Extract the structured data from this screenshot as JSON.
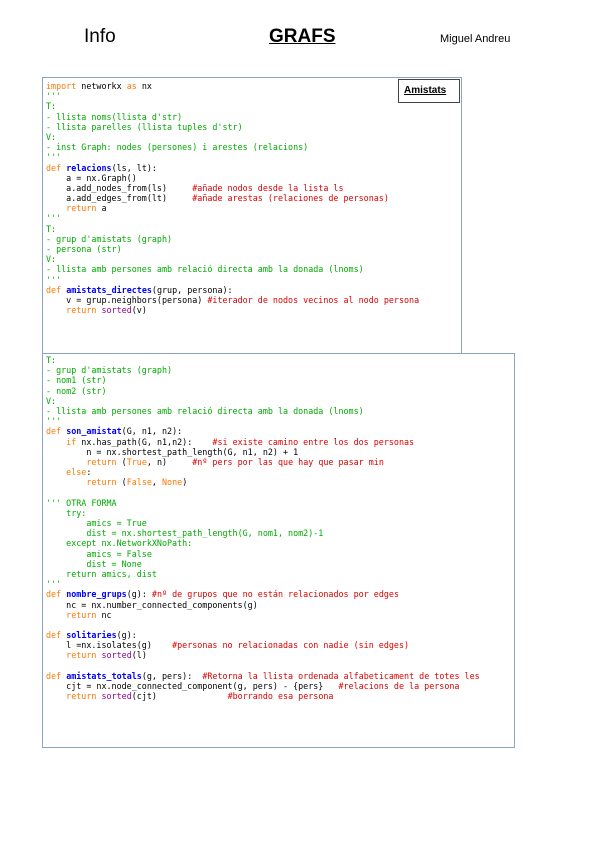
{
  "header": {
    "left": "Info",
    "title": "GRAFS",
    "author": "Miguel Andreu"
  },
  "tag": "Amistats",
  "block1": [
    [
      [
        "kw",
        "import"
      ],
      [
        "txt",
        " networkx "
      ],
      [
        "kw",
        "as"
      ],
      [
        "txt",
        " nx"
      ]
    ],
    [
      [
        "str",
        "'''"
      ]
    ],
    [
      [
        "str",
        "T:"
      ]
    ],
    [
      [
        "str",
        "- llista noms(llista d'str)"
      ]
    ],
    [
      [
        "str",
        "- llista parelles (llista tuples d'str)"
      ]
    ],
    [
      [
        "str",
        "V:"
      ]
    ],
    [
      [
        "str",
        "- inst Graph: nodes (persones) i arestes (relacions)"
      ]
    ],
    [
      [
        "str",
        "'''"
      ]
    ],
    [
      [
        "kw",
        "def"
      ],
      [
        "txt",
        " "
      ],
      [
        "fn",
        "relacions"
      ],
      [
        "txt",
        "(ls, lt):"
      ]
    ],
    [
      [
        "txt",
        "    a = nx.Graph()"
      ]
    ],
    [
      [
        "txt",
        "    a.add_nodes_from(ls)     "
      ],
      [
        "cmt",
        "#añade nodos desde la lista ls"
      ]
    ],
    [
      [
        "txt",
        "    a.add_edges_from(lt)     "
      ],
      [
        "cmt",
        "#añade arestas (relaciones de personas)"
      ]
    ],
    [
      [
        "txt",
        "    "
      ],
      [
        "kw",
        "return"
      ],
      [
        "txt",
        " a"
      ]
    ],
    [
      [
        "str",
        "'''"
      ]
    ],
    [
      [
        "str",
        "T:"
      ]
    ],
    [
      [
        "str",
        "- grup d'amistats (graph)"
      ]
    ],
    [
      [
        "str",
        "- persona (str)"
      ]
    ],
    [
      [
        "str",
        "V:"
      ]
    ],
    [
      [
        "str",
        "- llista amb persones amb relació directa amb la donada (lnoms)"
      ]
    ],
    [
      [
        "str",
        "'''"
      ]
    ],
    [
      [
        "kw",
        "def"
      ],
      [
        "txt",
        " "
      ],
      [
        "fn",
        "amistats_directes"
      ],
      [
        "txt",
        "(grup, persona):"
      ]
    ],
    [
      [
        "txt",
        "    v = grup.neighbors(persona) "
      ],
      [
        "cmt",
        "#iterador de nodos vecinos al nodo persona"
      ]
    ],
    [
      [
        "txt",
        "    "
      ],
      [
        "kw",
        "return"
      ],
      [
        "txt",
        " "
      ],
      [
        "bi",
        "sorted"
      ],
      [
        "txt",
        "(v)"
      ]
    ]
  ],
  "block2": [
    [
      [
        "str",
        "T:"
      ]
    ],
    [
      [
        "str",
        "- grup d'amistats (graph)"
      ]
    ],
    [
      [
        "str",
        "- nom1 (str)"
      ]
    ],
    [
      [
        "str",
        "- nom2 (str)"
      ]
    ],
    [
      [
        "str",
        "V:"
      ]
    ],
    [
      [
        "str",
        "- llista amb persones amb relació directa amb la donada (lnoms)"
      ]
    ],
    [
      [
        "str",
        "'''"
      ]
    ],
    [
      [
        "kw",
        "def"
      ],
      [
        "txt",
        " "
      ],
      [
        "fn",
        "son_amistat"
      ],
      [
        "txt",
        "(G, n1, n2):"
      ]
    ],
    [
      [
        "txt",
        "    "
      ],
      [
        "kw",
        "if"
      ],
      [
        "txt",
        " nx.has_path(G, n1,n2):    "
      ],
      [
        "cmt",
        "#si existe camino entre los dos personas"
      ]
    ],
    [
      [
        "txt",
        "        n = nx.shortest_path_length(G, n1, n2) + 1"
      ]
    ],
    [
      [
        "txt",
        "        "
      ],
      [
        "kw",
        "return"
      ],
      [
        "txt",
        " ("
      ],
      [
        "kw",
        "True"
      ],
      [
        "txt",
        ", n)     "
      ],
      [
        "cmt",
        "#nº pers por las que hay que pasar min"
      ]
    ],
    [
      [
        "txt",
        "    "
      ],
      [
        "kw",
        "else"
      ],
      [
        "txt",
        ":"
      ]
    ],
    [
      [
        "txt",
        "        "
      ],
      [
        "kw",
        "return"
      ],
      [
        "txt",
        " ("
      ],
      [
        "kw",
        "False"
      ],
      [
        "txt",
        ", "
      ],
      [
        "kw",
        "None"
      ],
      [
        "txt",
        ")"
      ]
    ],
    [
      [
        "txt",
        ""
      ]
    ],
    [
      [
        "str",
        "''' OTRA FORMA"
      ]
    ],
    [
      [
        "str",
        "    try:"
      ]
    ],
    [
      [
        "str",
        "        amics = True"
      ]
    ],
    [
      [
        "str",
        "        dist = nx.shortest_path_length(G, nom1, nom2)-1"
      ]
    ],
    [
      [
        "str",
        "    except nx.NetworkXNoPath:"
      ]
    ],
    [
      [
        "str",
        "        amics = False"
      ]
    ],
    [
      [
        "str",
        "        dist = None"
      ]
    ],
    [
      [
        "str",
        "    return amics, dist"
      ]
    ],
    [
      [
        "str",
        "'''"
      ]
    ],
    [
      [
        "kw",
        "def"
      ],
      [
        "txt",
        " "
      ],
      [
        "fn",
        "nombre_grups"
      ],
      [
        "txt",
        "(g): "
      ],
      [
        "cmt",
        "#nº de grupos que no están relacionados por edges"
      ]
    ],
    [
      [
        "txt",
        "    nc = nx.number_connected_components(g)"
      ]
    ],
    [
      [
        "txt",
        "    "
      ],
      [
        "kw",
        "return"
      ],
      [
        "txt",
        " nc"
      ]
    ],
    [
      [
        "txt",
        ""
      ]
    ],
    [
      [
        "kw",
        "def"
      ],
      [
        "txt",
        " "
      ],
      [
        "fn",
        "solitaries"
      ],
      [
        "txt",
        "(g):"
      ]
    ],
    [
      [
        "txt",
        "    l =nx.isolates(g)    "
      ],
      [
        "cmt",
        "#personas no relacionadas con nadie (sin edges)"
      ]
    ],
    [
      [
        "txt",
        "    "
      ],
      [
        "kw",
        "return"
      ],
      [
        "txt",
        " "
      ],
      [
        "bi",
        "sorted"
      ],
      [
        "txt",
        "(l)"
      ]
    ],
    [
      [
        "txt",
        ""
      ]
    ],
    [
      [
        "kw",
        "def"
      ],
      [
        "txt",
        " "
      ],
      [
        "fn",
        "amistats_totals"
      ],
      [
        "txt",
        "(g, pers):  "
      ],
      [
        "cmt",
        "#Retorna la llista ordenada alfabeticament de totes les"
      ]
    ],
    [
      [
        "txt",
        "    cjt = nx.node_connected_component(g, pers) - {pers}   "
      ],
      [
        "cmt",
        "#relacions de la persona"
      ]
    ],
    [
      [
        "txt",
        "    "
      ],
      [
        "kw",
        "return"
      ],
      [
        "txt",
        " "
      ],
      [
        "bi",
        "sorted"
      ],
      [
        "txt",
        "(cjt)              "
      ],
      [
        "cmt",
        "#borrando esa persona"
      ]
    ]
  ]
}
